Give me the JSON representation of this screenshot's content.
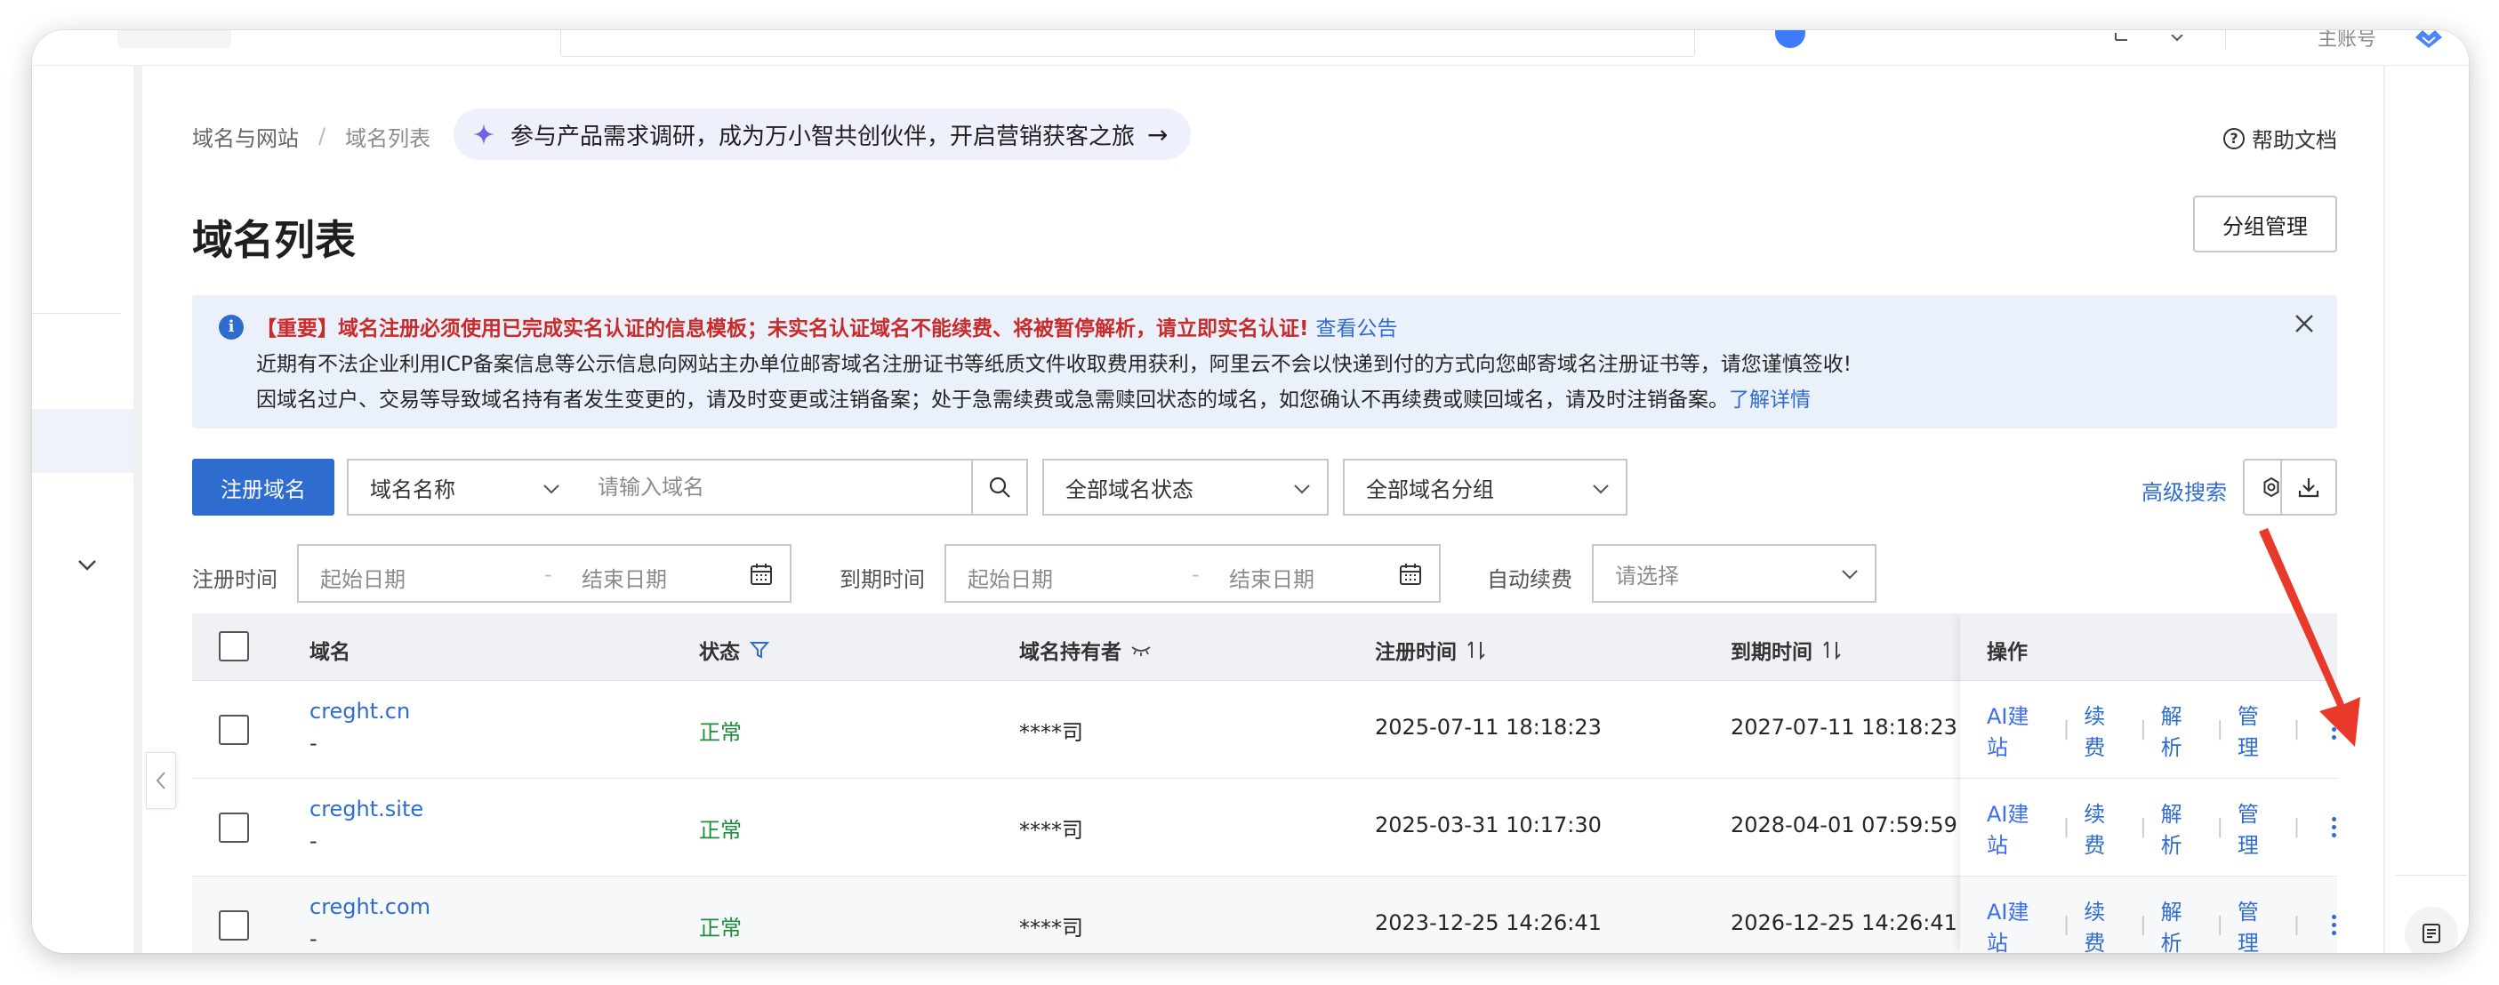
{
  "topbar": {
    "account_label": "主账号"
  },
  "breadcrumb": {
    "items": [
      "域名与网站",
      "域名列表"
    ],
    "separator": "/"
  },
  "promo": {
    "text": "参与产品需求调研，成为万小智共创伙伴，开启营销获客之旅",
    "arrow": "→"
  },
  "help": {
    "label": "帮助文档"
  },
  "page": {
    "title": "域名列表"
  },
  "actions": {
    "group_manage": "分组管理"
  },
  "notice": {
    "line1": "【重要】域名注册必须使用已完成实名认证的信息模板；未实名认证域名不能续费、将被暂停解析，请立即实名认证!",
    "line1_link": "查看公告",
    "line2": "近期有不法企业利用ICP备案信息等公示信息向网站主办单位邮寄域名注册证书等纸质文件收取费用获利，阿里云不会以快递到付的方式向您邮寄域名注册证书等，请您谨慎签收!",
    "line3": "因域名过户、交易等导致域名持有者发生变更的，请及时变更或注销备案；处于急需续费或急需赎回状态的域名，如您确认不再续费或赎回域名，请及时注销备案。",
    "line3_link": "了解详情"
  },
  "toolbar": {
    "register_button": "注册域名",
    "search_field_select": "域名名称",
    "search_placeholder": "请输入域名",
    "status_select": "全部域名状态",
    "group_select": "全部域名分组",
    "advanced_search": "高级搜索"
  },
  "filters": {
    "reg_time_label": "注册时间",
    "expire_time_label": "到期时间",
    "start_placeholder": "起始日期",
    "end_placeholder": "结束日期",
    "dash": "-",
    "auto_renew_label": "自动续费",
    "auto_renew_placeholder": "请选择"
  },
  "table": {
    "headers": {
      "domain": "域名",
      "status": "状态",
      "holder": "域名持有者",
      "reg_time": "注册时间",
      "expire_time": "到期时间",
      "ops": "操作"
    },
    "rows": [
      {
        "domain": "creght.cn",
        "sub": "-",
        "status": "正常",
        "holder": "****司",
        "reg_time": "2025-07-11 18:18:23",
        "expire_time": "2027-07-11 18:18:23"
      },
      {
        "domain": "creght.site",
        "sub": "-",
        "status": "正常",
        "holder": "****司",
        "reg_time": "2025-03-31 10:17:30",
        "expire_time": "2028-04-01 07:59:59"
      },
      {
        "domain": "creght.com",
        "sub": "-",
        "status": "正常",
        "holder": "****司",
        "reg_time": "2023-12-25 14:26:41",
        "expire_time": "2026-12-25 14:26:41"
      }
    ],
    "op_labels": {
      "ai_site": "AI建站",
      "renew": "续费",
      "dns": "解析",
      "manage": "管理",
      "sep": "|"
    }
  },
  "colors": {
    "primary": "#2f6cd0",
    "status_ok": "#1d8f3a",
    "notice_red": "#c92a2a",
    "notice_bg": "#ebf1fa",
    "annotation_arrow": "#e8392b"
  }
}
